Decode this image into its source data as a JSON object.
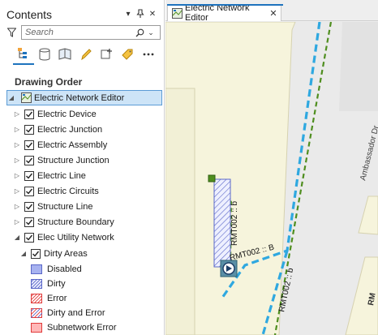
{
  "contents": {
    "title": "Contents",
    "search": {
      "placeholder": "Search"
    },
    "section_title": "Drawing Order"
  },
  "tree": {
    "map_name": "Electric Network Editor",
    "layers": [
      "Electric Device",
      "Electric Junction",
      "Electric Assembly",
      "Structure Junction",
      "Electric Line",
      "Electric Circuits",
      "Structure Line",
      "Structure Boundary",
      "Elec Utility Network"
    ],
    "sublayer": "Dirty Areas",
    "legend": [
      {
        "label": "Disabled",
        "fill": "#a7b2f0",
        "border": "#5a67c8",
        "pattern": "solid"
      },
      {
        "label": "Dirty",
        "fill": "#e9e9ff",
        "border": "#5a67c8",
        "pattern": "hatch-blue"
      },
      {
        "label": "Error",
        "fill": "#ffffff",
        "border": "#e13b3b",
        "pattern": "hatch-red"
      },
      {
        "label": "Dirty and Error",
        "fill": "#ffffff",
        "border": "#e13b3b",
        "pattern": "hatch-blue-red"
      },
      {
        "label": "Subnetwork Error",
        "fill": "#ffb7b7",
        "border": "#e13b3b",
        "pattern": "solid"
      }
    ]
  },
  "mapview": {
    "tab_label": "Electric Network Editor",
    "labels": {
      "street": "Ambassador Dr",
      "rmt_vertical": "RMT002 :: b",
      "rmt_horizontal": "RMT002 :: B",
      "rmt_lower": "RMT002 :: b",
      "edge_fragment": "RM"
    }
  },
  "colors": {
    "accent": "#1e73be",
    "selection_bg": "#cde4f7",
    "parcel": "#f6f4dc",
    "road": "#e9e9e9",
    "primary_line": "#2fa8e0",
    "secondary_line": "#4f8e1f"
  }
}
